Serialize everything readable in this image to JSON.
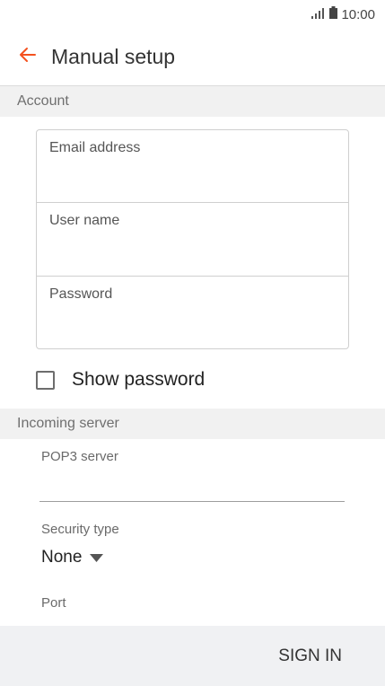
{
  "status_bar": {
    "time": "10:00",
    "signal_icon": "signal-icon",
    "battery_icon": "battery-icon"
  },
  "app_bar": {
    "back_icon": "arrow-left-icon",
    "title": "Manual setup",
    "accent_color": "#f4511e"
  },
  "account_section": {
    "header": "Account",
    "fields": [
      {
        "label": "Email address"
      },
      {
        "label": "User name"
      },
      {
        "label": "Password"
      }
    ],
    "show_password": {
      "label": "Show password",
      "checked": false
    }
  },
  "incoming_section": {
    "header": "Incoming server",
    "pop3_server": {
      "label": "POP3 server",
      "value": ""
    },
    "security_type": {
      "label": "Security type",
      "value": "None"
    },
    "port": {
      "label": "Port"
    }
  },
  "footer": {
    "sign_in_label": "SIGN IN"
  }
}
